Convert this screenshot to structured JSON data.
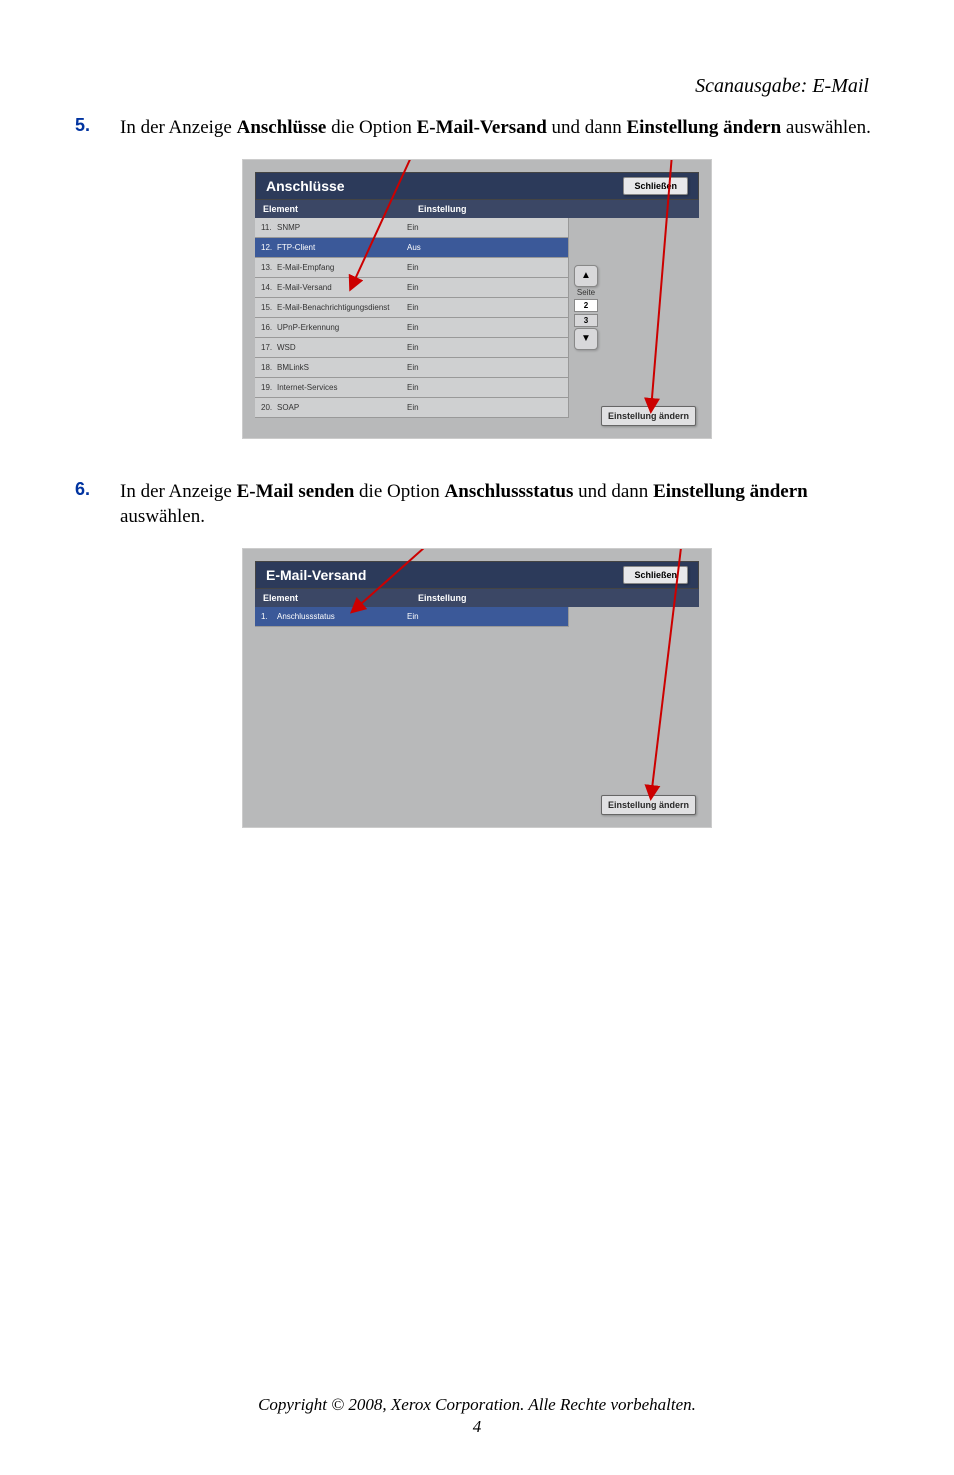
{
  "header": "Scanausgabe: E-Mail",
  "steps": [
    {
      "num": "5.",
      "pre": "In der Anzeige ",
      "b1": "Anschlüsse",
      "mid1": " die Option ",
      "b2": "E-Mail-Versand",
      "mid2": " und dann ",
      "b3": "Einstellung ändern",
      "post": " auswählen."
    },
    {
      "num": "6.",
      "pre": "In der Anzeige ",
      "b1": "E-Mail senden",
      "mid1": " die Option ",
      "b2": "Anschlussstatus",
      "mid2": " und dann ",
      "b3": "Einstellung ändern",
      "post": " auswählen."
    }
  ],
  "panel1": {
    "title": "Anschlüsse",
    "close_label": "Schließen",
    "col_element": "Element",
    "col_setting": "Einstellung",
    "rows": [
      {
        "num": "11.",
        "name": "SNMP",
        "val": "Ein",
        "selected": false
      },
      {
        "num": "12.",
        "name": "FTP-Client",
        "val": "Aus",
        "selected": true
      },
      {
        "num": "13.",
        "name": "E-Mail-Empfang",
        "val": "Ein",
        "selected": false
      },
      {
        "num": "14.",
        "name": "E-Mail-Versand",
        "val": "Ein",
        "selected": false
      },
      {
        "num": "15.",
        "name": "E-Mail-Benachrichtigungsdienst",
        "val": "Ein",
        "selected": false
      },
      {
        "num": "16.",
        "name": "UPnP-Erkennung",
        "val": "Ein",
        "selected": false
      },
      {
        "num": "17.",
        "name": "WSD",
        "val": "Ein",
        "selected": false
      },
      {
        "num": "18.",
        "name": "BMLinkS",
        "val": "Ein",
        "selected": false
      },
      {
        "num": "19.",
        "name": "Internet-Services",
        "val": "Ein",
        "selected": false
      },
      {
        "num": "20.",
        "name": "SOAP",
        "val": "Ein",
        "selected": false
      }
    ],
    "page_label": "Seite",
    "page_current": "2",
    "page_total": "3",
    "change_label": "Einstellung ändern"
  },
  "panel2": {
    "title": "E-Mail-Versand",
    "close_label": "Schließen",
    "col_element": "Element",
    "col_setting": "Einstellung",
    "rows": [
      {
        "num": "1.",
        "name": "Anschlussstatus",
        "val": "Ein",
        "selected": true
      }
    ],
    "change_label": "Einstellung ändern"
  },
  "footer": {
    "copyright": "Copyright © 2008, Xerox Corporation. Alle Rechte vorbehalten.",
    "page_num": "4"
  }
}
